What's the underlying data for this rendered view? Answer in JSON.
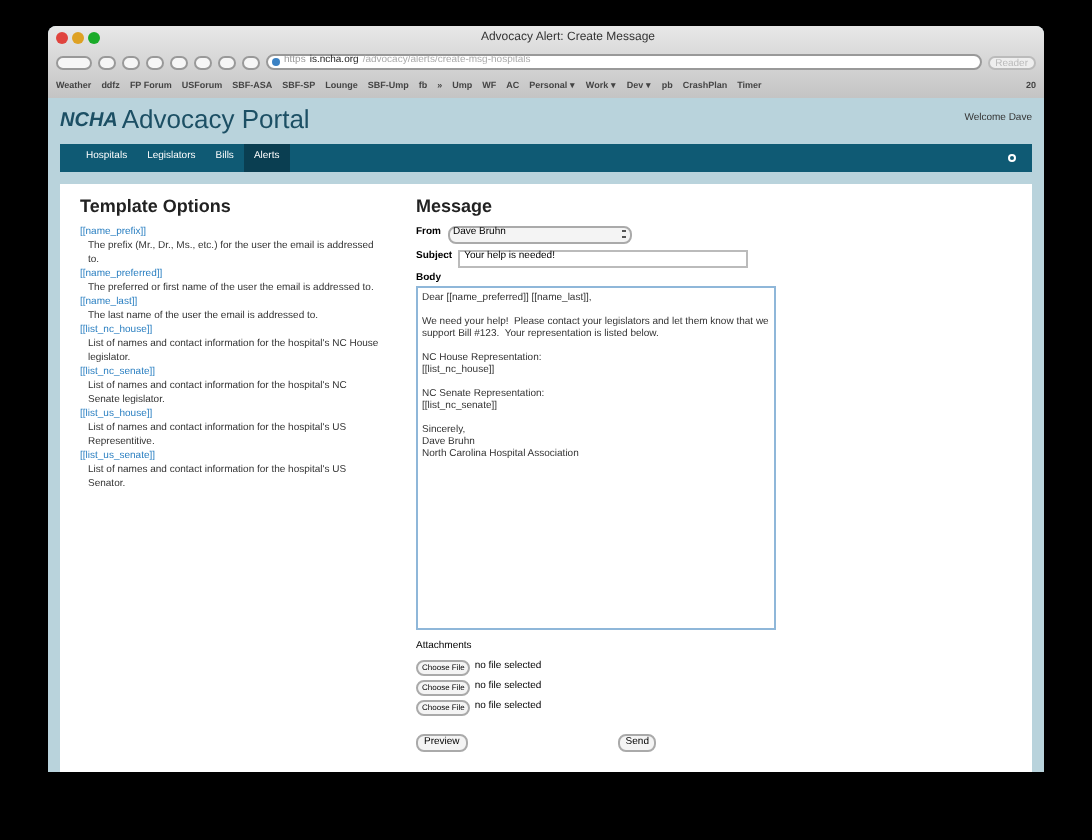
{
  "window": {
    "title": "Advocacy Alert: Create Message"
  },
  "address_bar": {
    "scheme": "https",
    "host": "is.ncha.org",
    "path": "/advocacy/alerts/create-msg-hospitals",
    "reader": "Reader"
  },
  "bookmarks": [
    "Weather",
    "ddfz",
    "FP Forum",
    "USForum",
    "SBF-ASA",
    "SBF-SP",
    "Lounge",
    "SBF-Ump",
    "fb",
    "»",
    "Ump",
    "WF",
    "AC",
    "Personal ▾",
    "Work ▾",
    "Dev ▾",
    "pb",
    "CrashPlan",
    "Timer"
  ],
  "bookmarks_count": "20",
  "header": {
    "logo": "NCHA",
    "title": "Advocacy Portal",
    "welcome": "Welcome Dave"
  },
  "nav": [
    {
      "label": "Hospitals",
      "selected": false
    },
    {
      "label": "Legislators",
      "selected": false
    },
    {
      "label": "Bills",
      "selected": false
    },
    {
      "label": "Alerts",
      "selected": true
    }
  ],
  "template_options": {
    "title": "Template Options",
    "items": [
      {
        "tag": "[[name_prefix]]",
        "description": "The prefix (Mr., Dr., Ms., etc.) for the user the email is addressed to."
      },
      {
        "tag": "[[name_preferred]]",
        "description": "The preferred or first name of the user the email is addressed to."
      },
      {
        "tag": "[[name_last]]",
        "description": "The last name of the user the email is addressed to."
      },
      {
        "tag": "[[list_nc_house]]",
        "description": "List of names and contact information for the hospital's NC House legislator."
      },
      {
        "tag": "[[list_nc_senate]]",
        "description": "List of names and contact information for the hospital's NC Senate legislator."
      },
      {
        "tag": "[[list_us_house]]",
        "description": "List of names and contact information for the hospital's US Representitive."
      },
      {
        "tag": "[[list_us_senate]]",
        "description": "List of names and contact information for the hospital's US Senator."
      }
    ]
  },
  "message": {
    "title": "Message",
    "from_label": "From",
    "from_value": "Dave Bruhn",
    "subject_label": "Subject",
    "subject_value": "Your help is needed!",
    "body_label": "Body",
    "body": "Dear [[name_preferred]] [[name_last]],\n\nWe need your help!  Please contact your legislators and let them know that we support Bill #123.  Your representation is listed below.\n\nNC House Representation:\n[[list_nc_house]]\n\nNC Senate Representation:\n[[list_nc_senate]]\n\nSincerely,\nDave Bruhn\nNorth Carolina Hospital Association",
    "attachments_label": "Attachments",
    "attachments": [
      {
        "button": "Choose File",
        "status": "no file selected"
      },
      {
        "button": "Choose File",
        "status": "no file selected"
      },
      {
        "button": "Choose File",
        "status": "no file selected"
      }
    ],
    "preview": "Preview",
    "send": "Send"
  }
}
